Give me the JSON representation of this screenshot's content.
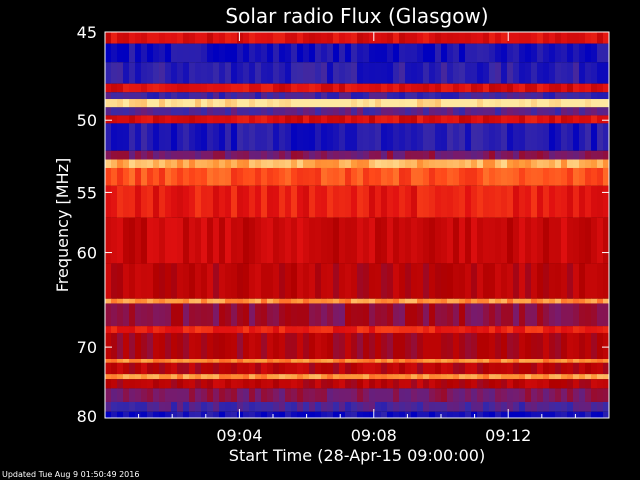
{
  "chart_data": {
    "type": "heatmap",
    "title": "Solar radio Flux (Glasgow)",
    "xlabel": "Start Time (28-Apr-15 09:00:00)",
    "ylabel": "Frequency [MHz]",
    "x_tick_labels": [
      "09:04",
      "09:08",
      "09:12"
    ],
    "x_ticks_minutes": [
      4,
      8,
      12
    ],
    "xlim_minutes": [
      0,
      15
    ],
    "y_tick_labels": [
      "45",
      "50",
      "55",
      "60",
      "70",
      "80"
    ],
    "y_ticks": [
      45,
      50,
      55,
      60,
      70,
      80
    ],
    "ylim": [
      45,
      80
    ],
    "y_scale": "reciprocal",
    "colormap": [
      "#0000c0",
      "#3a2aa8",
      "#7a1a6a",
      "#b00000",
      "#e01010",
      "#ff4a1a",
      "#ff9a3a",
      "#ffe8a0"
    ],
    "bands": [
      {
        "from": 45,
        "to": 45.6,
        "level": 0.55
      },
      {
        "from": 45.6,
        "to": 46.6,
        "level": 0.05
      },
      {
        "from": 46.6,
        "to": 47.8,
        "level": 0.1
      },
      {
        "from": 47.8,
        "to": 48.3,
        "level": 0.55
      },
      {
        "from": 48.3,
        "to": 48.7,
        "level": 0.15
      },
      {
        "from": 48.7,
        "to": 49.2,
        "level": 1.0
      },
      {
        "from": 49.2,
        "to": 49.7,
        "level": 0.2
      },
      {
        "from": 49.7,
        "to": 50.2,
        "level": 0.55
      },
      {
        "from": 50.2,
        "to": 52.0,
        "level": 0.08
      },
      {
        "from": 52.0,
        "to": 52.6,
        "level": 0.3
      },
      {
        "from": 52.6,
        "to": 53.2,
        "level": 0.9
      },
      {
        "from": 53.2,
        "to": 54.5,
        "level": 0.72
      },
      {
        "from": 54.5,
        "to": 57.0,
        "level": 0.6
      },
      {
        "from": 57.0,
        "to": 61.0,
        "level": 0.5
      },
      {
        "from": 61.0,
        "to": 64.5,
        "level": 0.45
      },
      {
        "from": 64.5,
        "to": 65.0,
        "level": 0.85
      },
      {
        "from": 65.0,
        "to": 67.5,
        "level": 0.35
      },
      {
        "from": 67.5,
        "to": 68.3,
        "level": 0.62
      },
      {
        "from": 68.3,
        "to": 71.5,
        "level": 0.42
      },
      {
        "from": 71.5,
        "to": 72.0,
        "level": 0.82
      },
      {
        "from": 72.0,
        "to": 73.5,
        "level": 0.45
      },
      {
        "from": 73.5,
        "to": 74.2,
        "level": 0.85
      },
      {
        "from": 74.2,
        "to": 75.5,
        "level": 0.45
      },
      {
        "from": 75.5,
        "to": 77.5,
        "level": 0.3
      },
      {
        "from": 77.5,
        "to": 79.0,
        "level": 0.18
      },
      {
        "from": 79.0,
        "to": 80.0,
        "level": 0.05
      }
    ],
    "grid": false
  },
  "footer": {
    "updated": "Updated Tue Aug  9 01:50:49 2016"
  }
}
